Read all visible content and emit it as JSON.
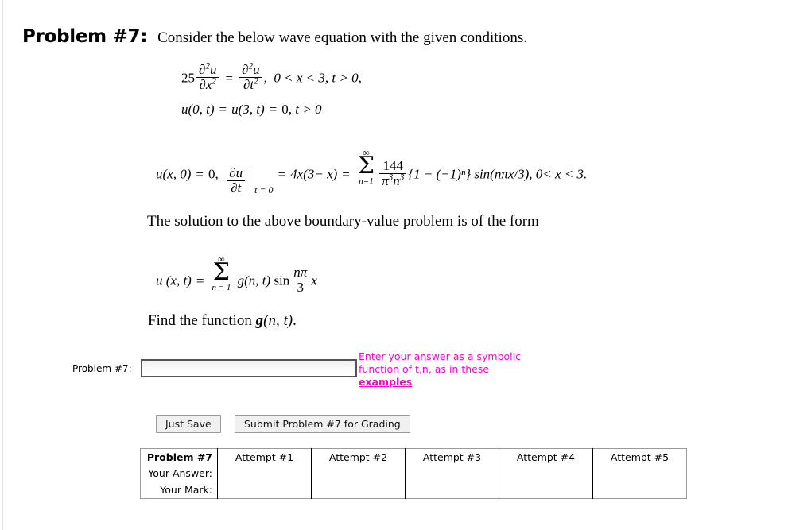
{
  "page": {
    "problem_label": "Problem #7:",
    "prompt": "Consider the below wave equation with the given conditions.",
    "solution_text": "The solution to the above boundary-value problem is of the form",
    "find_text_prefix": "Find the function ",
    "find_text_fn": "g",
    "find_text_args": "(n, t)",
    "find_text_suffix": "."
  },
  "equations": {
    "pde": {
      "coefficient": "25",
      "lhs_num": "∂²u",
      "lhs_den": "∂x²",
      "equals": "=",
      "rhs_num": "∂²u",
      "rhs_den": "∂t²",
      "comma": ",",
      "domain_x": "0 < x < 3,",
      "domain_t": "t > 0,"
    },
    "boundary": {
      "left": "u(0, t)",
      "eq1": "=",
      "mid": "u(3, t)",
      "eq2": "=",
      "value": "0,",
      "domain_t": "t > 0"
    },
    "initial": {
      "u_zero": "u(x, 0)",
      "eq1": "=",
      "zero": "0,",
      "deriv_num": "∂u",
      "deriv_den": "∂t",
      "eval_at": "t = 0",
      "eq2": "=",
      "expr": "4x(3− x)",
      "eq3": "=",
      "sum_top": "∞",
      "sum_symbol": "Σ",
      "sum_bottom": "n=1",
      "frac_num": "144",
      "frac_den": "π³n³",
      "brace_expr": "{1 − (−1)ⁿ}",
      "sine": "sin(nπx/3),",
      "domain": "0< x < 3."
    },
    "solution_form": {
      "lhs": "u (x, t)",
      "equals": "=",
      "sum_top": "∞",
      "sum_symbol": "Σ",
      "sum_bottom": "n = 1",
      "g_fn": "g(n, t)",
      "sin": "sin",
      "frac_num": "nπ",
      "frac_den": "3",
      "trailing_x": "x"
    }
  },
  "answer": {
    "label": "Problem #7:",
    "input_value": "",
    "input_placeholder": "",
    "hint_line1": "Enter your answer as a symbolic",
    "hint_line2": "function of t,n, as in these",
    "hint_link": "examples",
    "hint_color": "#ff00cc"
  },
  "buttons": {
    "just_save": "Just Save",
    "submit": "Submit Problem #7 for Grading"
  },
  "attempts_table": {
    "corner_label": "Problem #7",
    "row_labels": [
      "Your Answer:",
      "Your Mark:"
    ],
    "columns": [
      "Attempt #1",
      "Attempt #2",
      "Attempt #3",
      "Attempt #4",
      "Attempt #5"
    ],
    "answers": [
      "",
      "",
      "",
      "",
      ""
    ],
    "marks": [
      "",
      "",
      "",
      "",
      ""
    ]
  }
}
